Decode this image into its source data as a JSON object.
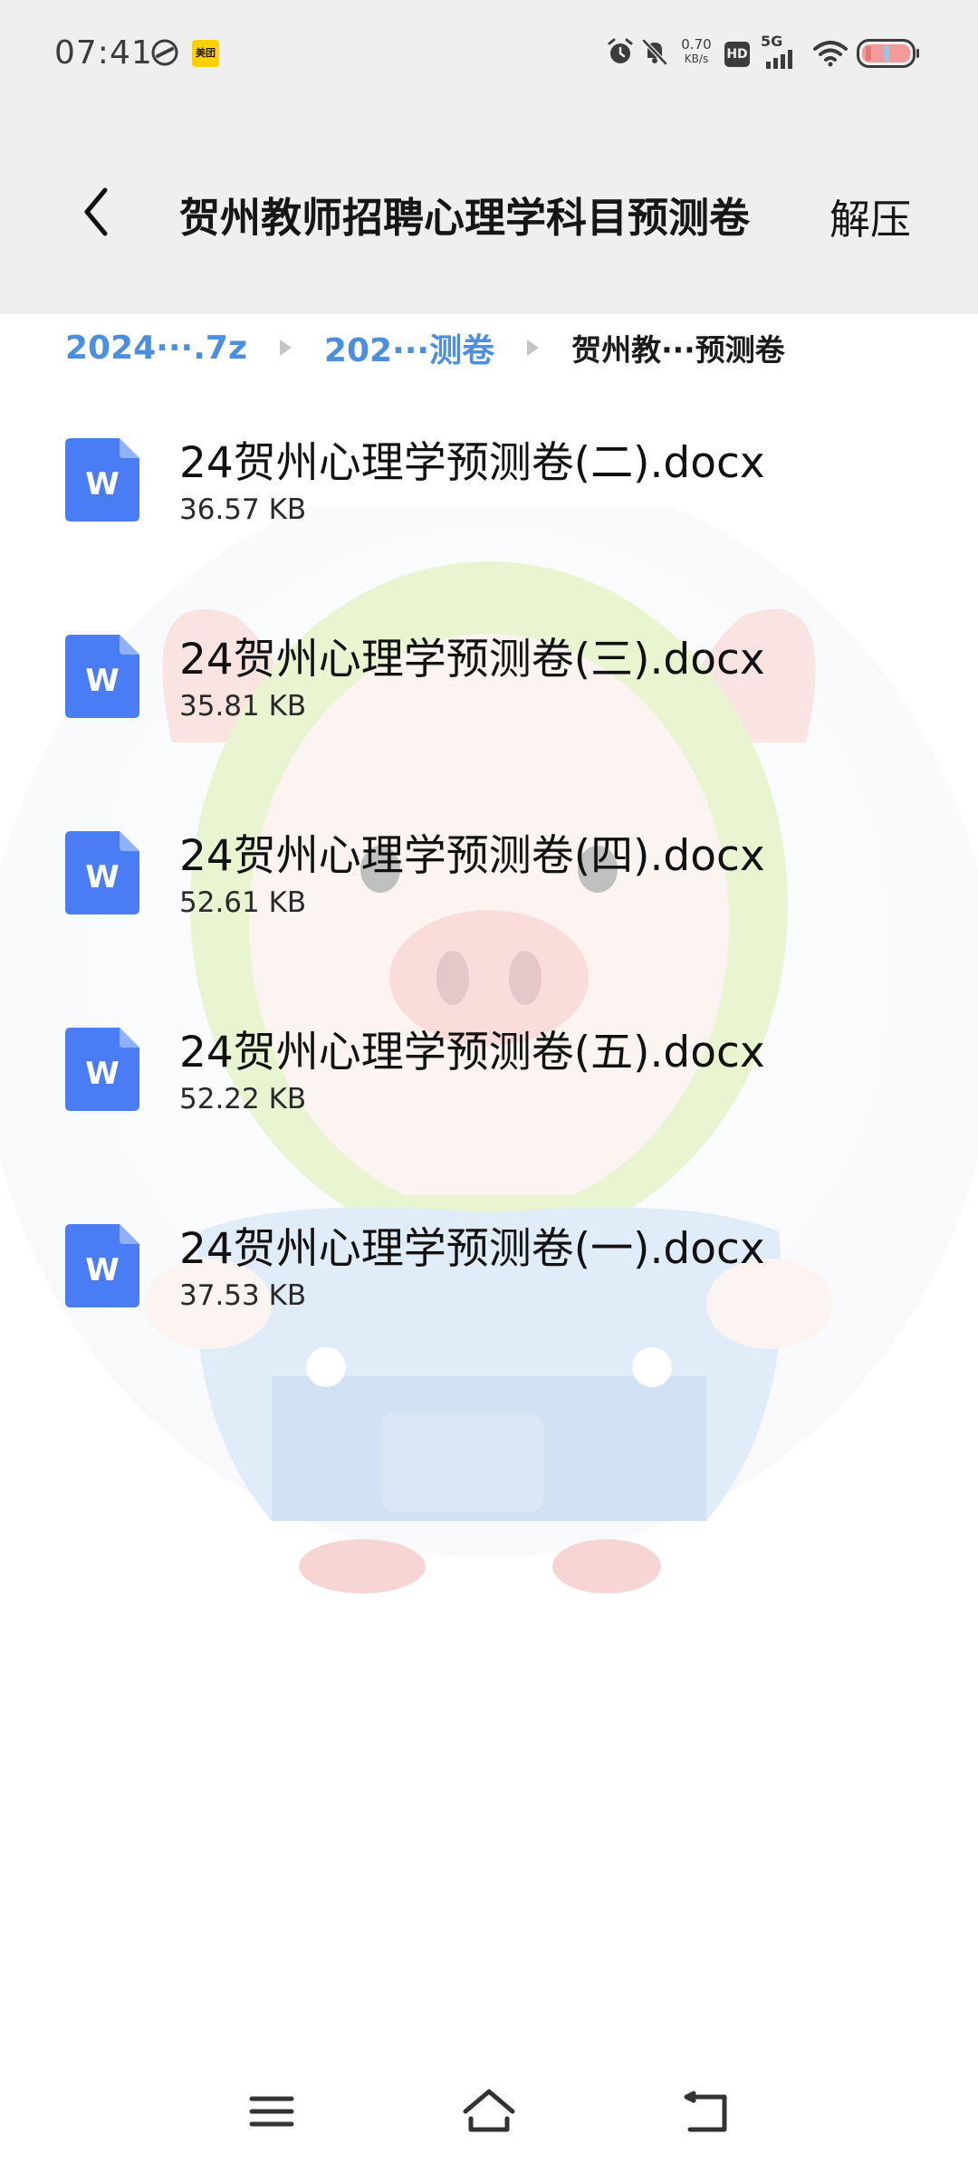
{
  "status_bar": {
    "time": "07:41",
    "app_badge": "美团",
    "net_speed_value": "0.70",
    "net_speed_unit": "KB/s",
    "hd_label": "HD",
    "network_label": "5G"
  },
  "header": {
    "title": "贺州教师招聘心理学科目预测卷",
    "extract_label": "解压"
  },
  "breadcrumb": {
    "items": [
      {
        "label": "2024···.7z"
      },
      {
        "label": "202···测卷"
      },
      {
        "label": "贺州教···预测卷"
      }
    ]
  },
  "files": [
    {
      "name": "24贺州心理学预测卷(二).docx",
      "size": "36.57 KB",
      "icon_letter": "W"
    },
    {
      "name": "24贺州心理学预测卷(三).docx",
      "size": "35.81 KB",
      "icon_letter": "W"
    },
    {
      "name": "24贺州心理学预测卷(四).docx",
      "size": "52.61 KB",
      "icon_letter": "W"
    },
    {
      "name": "24贺州心理学预测卷(五).docx",
      "size": "52.22 KB",
      "icon_letter": "W"
    },
    {
      "name": "24贺州心理学预测卷(一).docx",
      "size": "37.53 KB",
      "icon_letter": "W"
    }
  ],
  "theme": {
    "accent": "#4a8fe0",
    "doc_icon": "#4a7cf5",
    "header_bg": "#efefef"
  }
}
